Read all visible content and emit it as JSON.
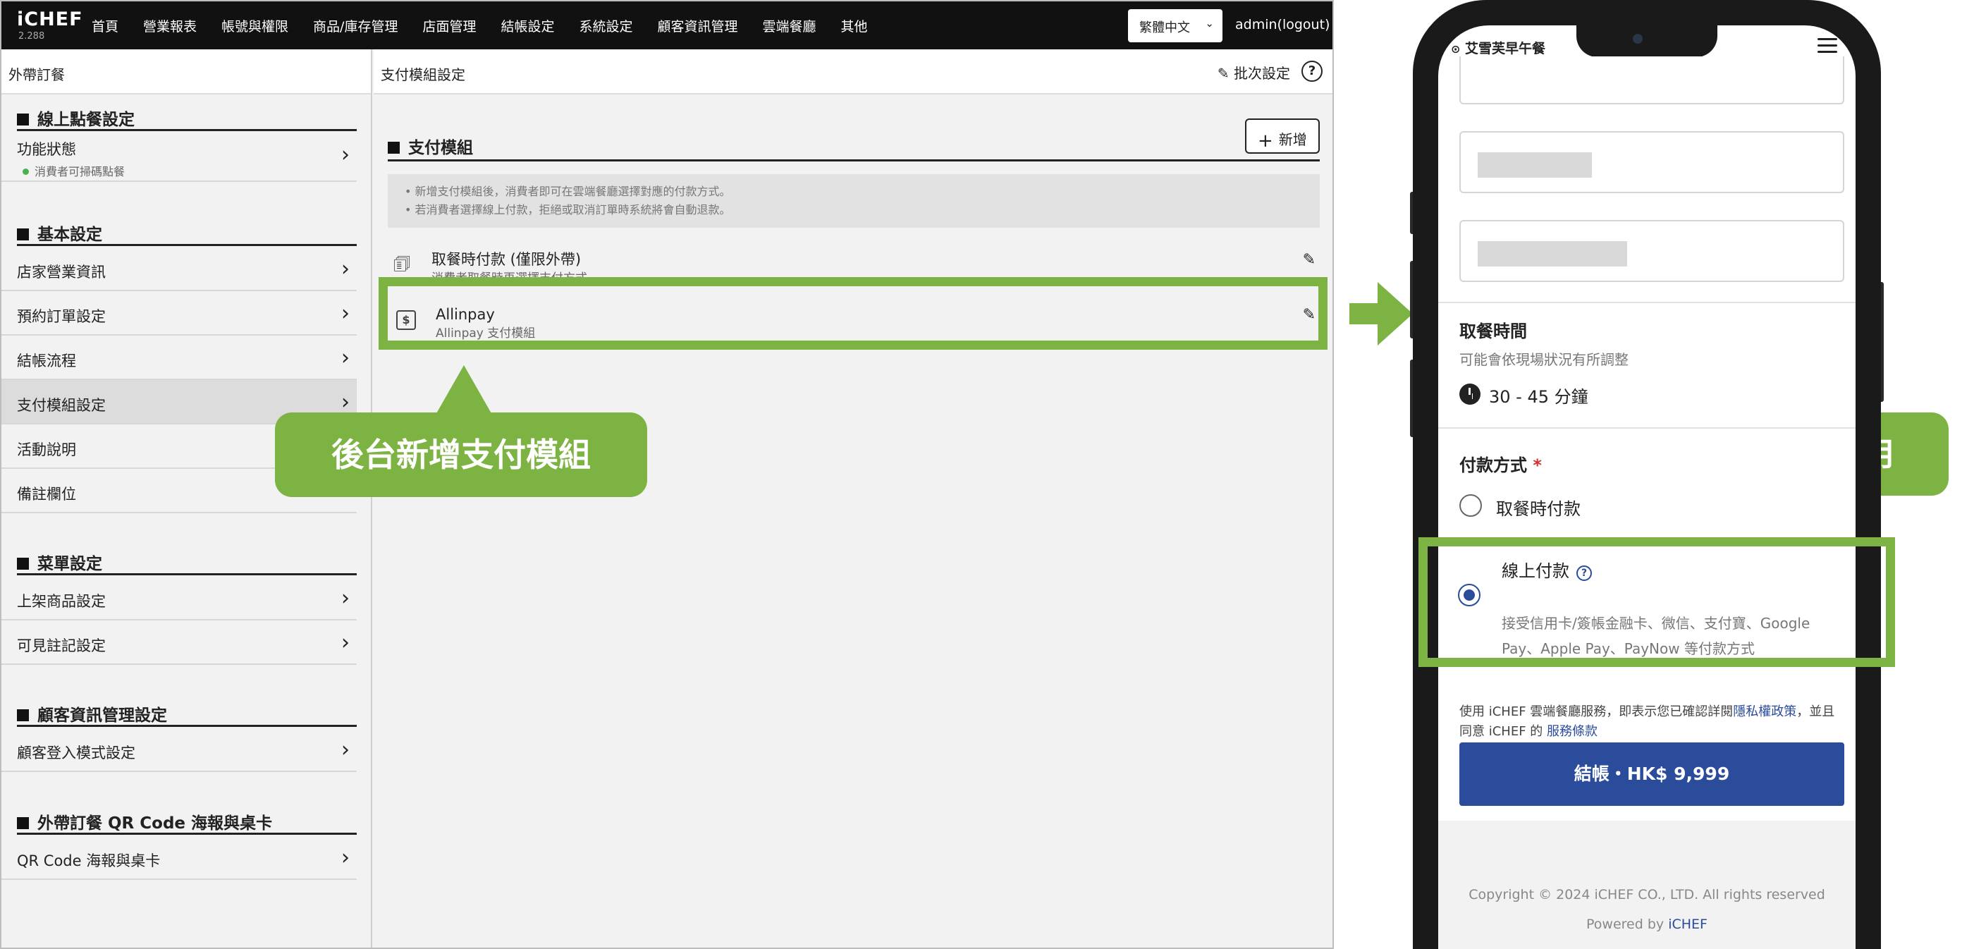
{
  "admin": {
    "logo": "iCHEF",
    "version": "2.288",
    "nav": [
      "首頁",
      "營業報表",
      "帳號與權限",
      "商品/庫存管理",
      "店面管理",
      "結帳設定",
      "系統設定",
      "顧客資訊管理",
      "雲端餐廳",
      "其他"
    ],
    "language": "繁體中文",
    "user": "admin(logout)",
    "sidebar": {
      "header": "外帶訂餐",
      "sections": [
        {
          "title": "線上點餐設定",
          "items": [
            {
              "label": "功能狀態",
              "sub": "消費者可掃碼點餐"
            }
          ]
        },
        {
          "title": "基本設定",
          "items": [
            {
              "label": "店家營業資訊"
            },
            {
              "label": "預約訂單設定"
            },
            {
              "label": "結帳流程"
            },
            {
              "label": "支付模組設定"
            },
            {
              "label": "活動說明"
            },
            {
              "label": "備註欄位"
            }
          ]
        },
        {
          "title": "菜單設定",
          "items": [
            {
              "label": "上架商品設定"
            },
            {
              "label": "可見註記設定"
            }
          ]
        },
        {
          "title": "顧客資訊管理設定",
          "items": [
            {
              "label": "顧客登入模式設定"
            }
          ]
        },
        {
          "title": "外帶訂餐 QR Code 海報與桌卡",
          "items": [
            {
              "label": "QR Code 海報與桌卡"
            }
          ]
        }
      ]
    },
    "content": {
      "header": "支付模組設定",
      "batch_label": "批次設定",
      "help": "?",
      "section_title": "支付模組",
      "add_label": "新增",
      "notes": [
        "新增支付模組後，消費者即可在雲端餐廳選擇對應的付款方式。",
        "若消費者選擇線上付款，拒絕或取消訂單時系統將會自動退款。"
      ],
      "modules": [
        {
          "name": "取餐時付款 (僅限外帶)",
          "desc": "消費者取餐時再選擇支付方式"
        },
        {
          "name": "Allinpay",
          "desc": "Allinpay 支付模組"
        }
      ]
    }
  },
  "callouts": {
    "admin": "後台新增支付模組",
    "consumer": "消費者可選用"
  },
  "phone": {
    "shop_name": "艾雪芙早午餐",
    "pickup_title": "取餐時間",
    "pickup_sub": "可能會依現場狀況有所調整",
    "pickup_time": "30 - 45 分鐘",
    "payment_title": "付款方式",
    "required_mark": "*",
    "options": [
      {
        "label": "取餐時付款",
        "selected": false
      },
      {
        "label": "線上付款",
        "selected": true,
        "desc": "接受信用卡/簽帳金融卡、微信、支付寶、Google Pay、Apple Pay、PayNow 等付款方式"
      }
    ],
    "terms_prefix": "使用 iCHEF 雲端餐廳服務，即表示您已確認詳閱",
    "privacy_link": "隱私權政策",
    "terms_mid": "，並且同意 iCHEF 的",
    "service_link": "服務條款",
    "checkout_label": "結帳・HK$ 9,999",
    "copyright": "Copyright © 2024 iCHEF CO., LTD. All rights reserved",
    "powered_prefix": "Powered by",
    "powered_brand": "iCHEF"
  },
  "colors": {
    "accent_green": "#7cb342",
    "brand_blue": "#2b4b9b",
    "topbar": "#111111"
  }
}
